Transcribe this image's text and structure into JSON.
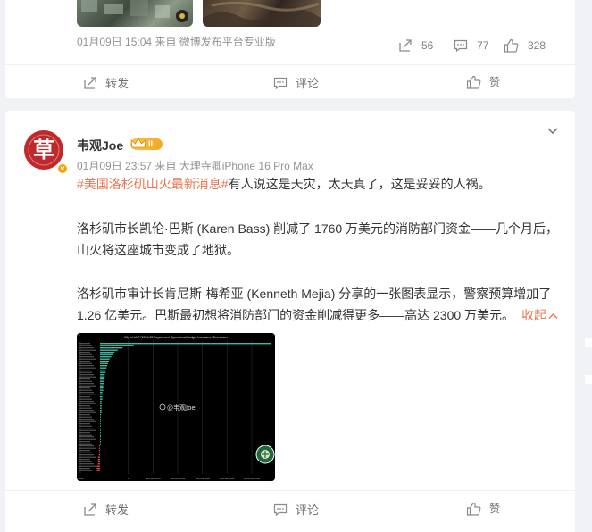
{
  "post1": {
    "meta": "01月09日 15:04 来自 微博发布平台专业版",
    "stats": {
      "repost": "56",
      "comment": "77",
      "like": "328"
    },
    "actions": {
      "repost": "转发",
      "comment": "评论",
      "like": "赞"
    }
  },
  "post2": {
    "username": "韦观Joe",
    "level": "II",
    "avatar_char": "草",
    "verified": "v",
    "meta": "01月09日 23:57  来自 大理寺卿iPhone 16 Pro Max",
    "topic": "#美国洛杉矶山火最新消息#",
    "line1_rest": "有人说这是天灾，太天真了，这是妥妥的人祸。",
    "para2": "洛杉矶市长凯伦·巴斯 (Karen Bass) 削减了 1760 万美元的消防部门资金——几个月后，山火将这座城市变成了地狱。",
    "para3": "洛杉矶市审计长肯尼斯·梅希亚 (Kenneth Mejia) 分享的一张图表显示，警察预算增加了 1.26 亿美元。巴斯最初想将消防部门的资金削减得更多——高达 2300 万美元。",
    "collapse": "收起",
    "image": {
      "title": "City of LA FY2024-25 Department Operational Budget Increases / Decreases",
      "watermark": "@韦观Joe",
      "ticks": [
        "-20M",
        "0",
        "$20,000,000",
        "$40,000,000",
        "$60,000,000",
        "$80,000,000",
        "$100,000,000"
      ]
    },
    "actions": {
      "repost": "转发",
      "comment": "评论",
      "like": "赞"
    }
  },
  "colors": {
    "accent": "#eb7350",
    "meta": "#939393",
    "bg": "#f1f2f5"
  }
}
